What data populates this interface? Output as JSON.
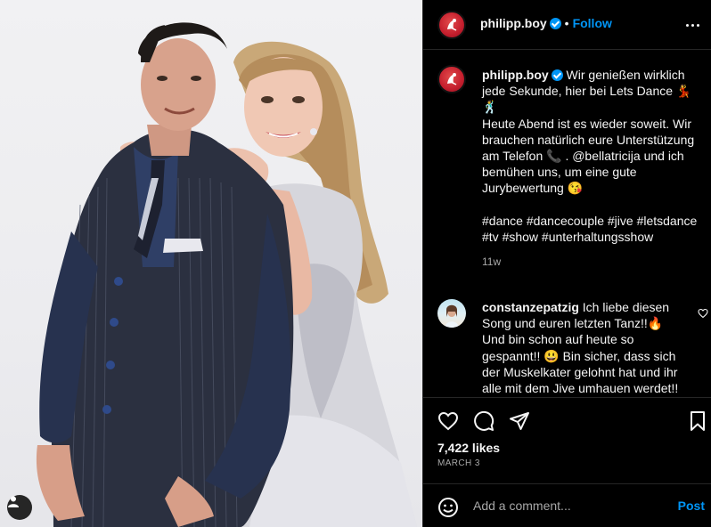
{
  "post": {
    "username": "philipp.boy",
    "follow_label": "Follow",
    "separator": "•",
    "caption": "Wir genießen wirklich jede Sekunde, hier bei Lets Dance 💃🕺\nHeute Abend ist es wieder soweit. Wir brauchen natürlich eure Unterstützung am Telefon 📞 . @bellatricija und ich bemühen uns, um eine gute Jurybewertung 😘\n\n#dance #dancecouple #jive #letsdance #tv #show #unterhaltungsshow",
    "caption_age": "11w"
  },
  "comment": {
    "username": "constanzepatzig",
    "text": "Ich liebe diesen Song und euren letzten Tanz!!🔥 Und bin schon auf heute so gespannt!! 😃 Bin sicher, dass sich der Muskelkater gelohnt hat und ihr alle mit dem Jive umhauen werdet!!"
  },
  "actions": {
    "likes": "7,422 likes",
    "date": "MARCH 3"
  },
  "composer": {
    "placeholder": "Add a comment...",
    "post_label": "Post"
  },
  "icons": {
    "more": "more-horizontal-icon",
    "like": "heart-icon",
    "comment": "comment-icon",
    "share": "send-icon",
    "save": "bookmark-icon",
    "emoji": "emoji-icon",
    "tag": "user-tag-icon"
  },
  "colors": {
    "accent": "#0095f6",
    "background": "#000000",
    "border": "#262626",
    "secondary_text": "#a8a8a8",
    "brand_avatar": "#c41e2d"
  }
}
